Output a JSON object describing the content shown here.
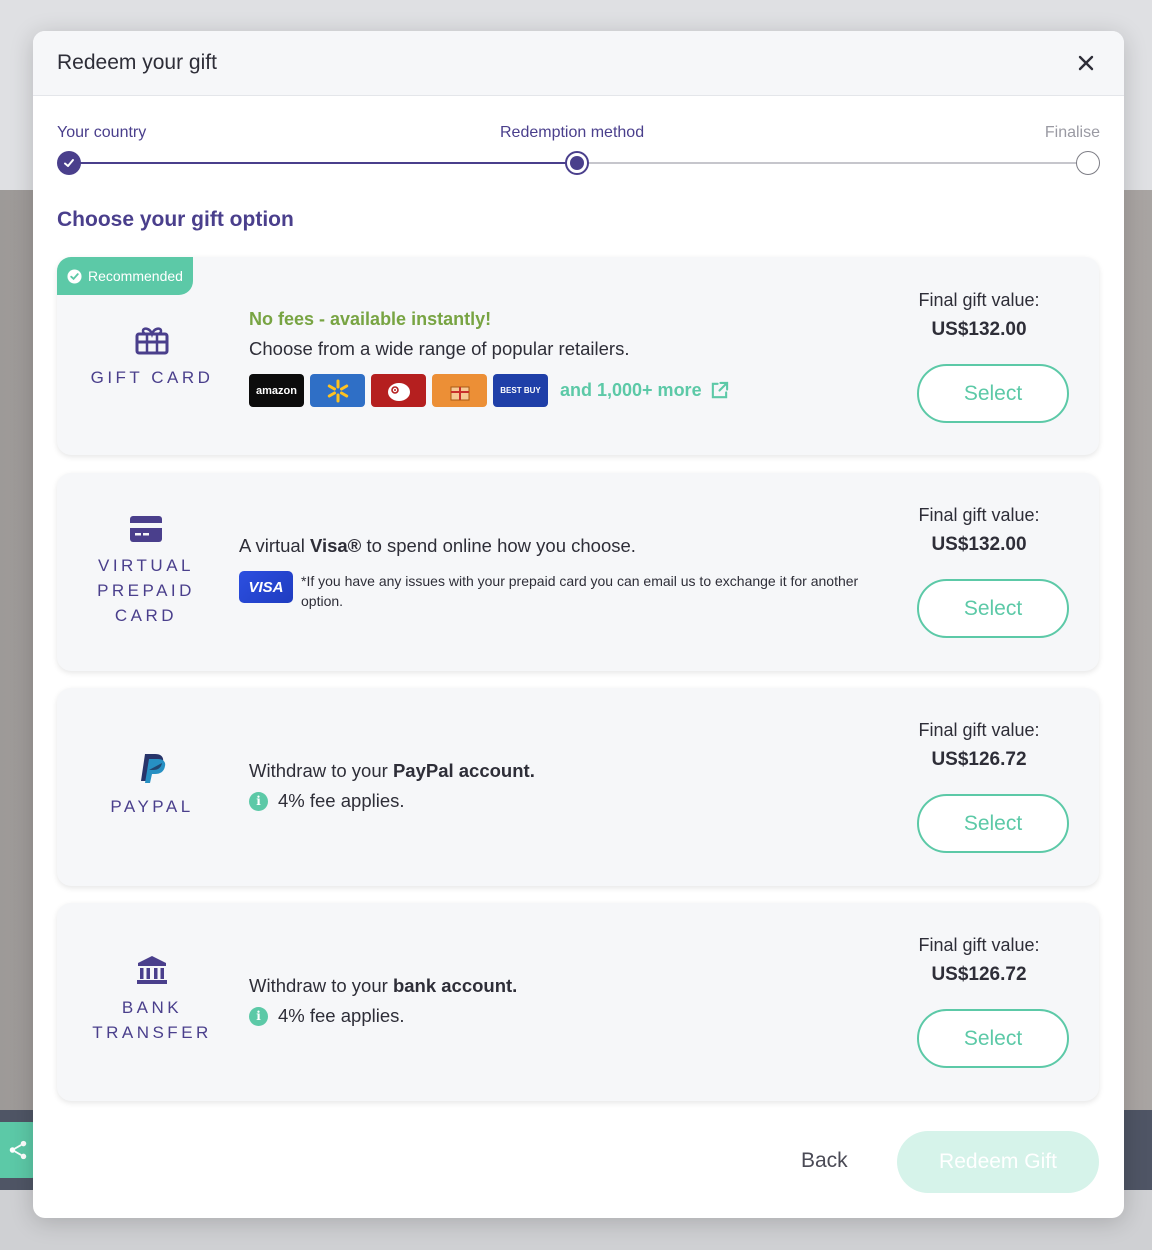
{
  "modal": {
    "title": "Redeem your gift"
  },
  "stepper": {
    "steps": [
      {
        "label": "Your country",
        "state": "done"
      },
      {
        "label": "Redemption method",
        "state": "current"
      },
      {
        "label": "Finalise",
        "state": "todo"
      }
    ]
  },
  "section_title": "Choose your gift option",
  "colors": {
    "accent": "#4a3f8c",
    "mint": "#5cc9a7",
    "green_text": "#78a443"
  },
  "options": [
    {
      "badge": "Recommended",
      "method": "GIFT CARD",
      "icon": "gift-icon",
      "headline": "No fees - available instantly!",
      "text": "Choose from a wide range of popular retailers.",
      "retailers": [
        "amazon",
        "Walmart",
        "Target",
        "Gift",
        "BEST BUY"
      ],
      "more_link": "and 1,000+ more",
      "value_label": "Final gift value:",
      "value": "US$132.00",
      "button": "Select"
    },
    {
      "method_lines": [
        "VIRTUAL",
        "PREPAID",
        "CARD"
      ],
      "icon": "credit-card-icon",
      "text_pre": "A virtual ",
      "text_bold": "Visa®",
      "text_post": " to spend online how you choose.",
      "visa_badge": "VISA",
      "note": "*If you have any issues with your prepaid card you can email us to exchange it for another option.",
      "value_label": "Final gift value:",
      "value": "US$132.00",
      "button": "Select"
    },
    {
      "method": "PAYPAL",
      "icon": "paypal-icon",
      "text_pre": "Withdraw to your ",
      "text_bold": "PayPal account.",
      "fee": "4% fee applies.",
      "value_label": "Final gift value:",
      "value": "US$126.72",
      "button": "Select"
    },
    {
      "method_lines": [
        "BANK",
        "TRANSFER"
      ],
      "icon": "bank-icon",
      "text_pre": "Withdraw to your ",
      "text_bold": "bank account.",
      "fee": "4% fee applies.",
      "value_label": "Final gift value:",
      "value": "US$126.72",
      "button": "Select"
    }
  ],
  "footer": {
    "back": "Back",
    "redeem": "Redeem Gift"
  }
}
